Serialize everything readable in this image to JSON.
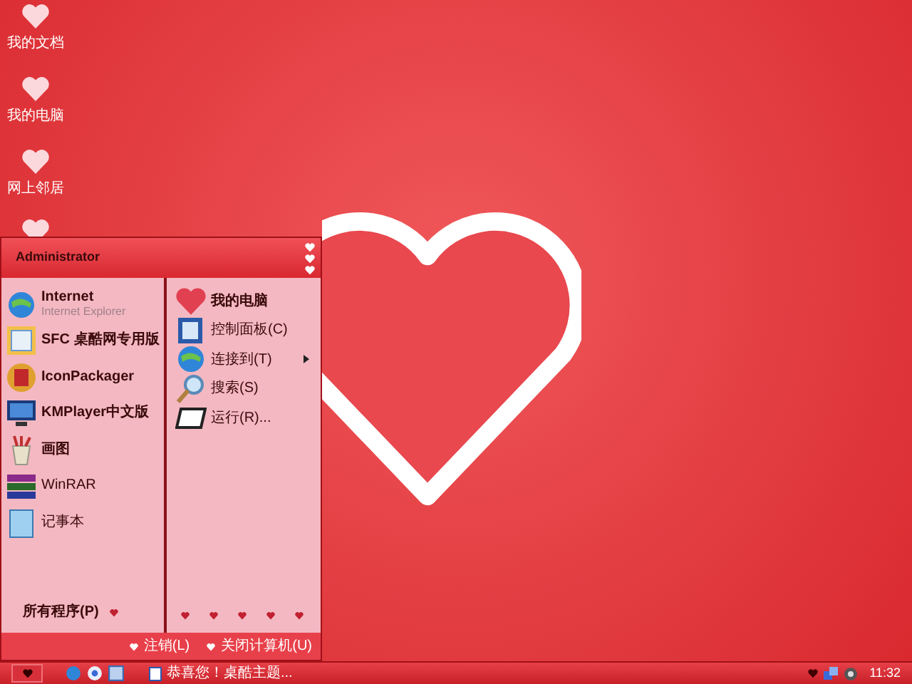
{
  "desktop_icons": [
    {
      "label": "我的文档"
    },
    {
      "label": "我的电脑"
    },
    {
      "label": "网上邻居"
    }
  ],
  "start_menu": {
    "user": "Administrator",
    "left_items": [
      {
        "kind": "pinned",
        "label": "Internet",
        "sublabel": "Internet Explorer"
      },
      {
        "kind": "pinned",
        "label": "SFC 桌酷网专用版"
      },
      {
        "kind": "pinned",
        "label": "IconPackager"
      },
      {
        "kind": "pinned",
        "label": "KMPlayer中文版"
      },
      {
        "kind": "pinned",
        "label": "画图"
      },
      {
        "kind": "recent",
        "label": "WinRAR"
      },
      {
        "kind": "recent",
        "label": "记事本"
      }
    ],
    "all_programs": "所有程序(P)",
    "right_items": [
      {
        "label": "我的电脑",
        "bold": true,
        "submenu": false
      },
      {
        "label": "控制面板(C)",
        "bold": false,
        "submenu": false
      },
      {
        "label": "连接到(T)",
        "bold": false,
        "submenu": true
      },
      {
        "label": "搜索(S)",
        "bold": false,
        "submenu": false
      },
      {
        "label": "运行(R)...",
        "bold": false,
        "submenu": false
      }
    ],
    "footer": [
      {
        "label": "注销(L)"
      },
      {
        "label": "关闭计算机(U)"
      }
    ]
  },
  "taskbar": {
    "task": "恭喜您！桌酷主题...",
    "clock": "11:32"
  }
}
